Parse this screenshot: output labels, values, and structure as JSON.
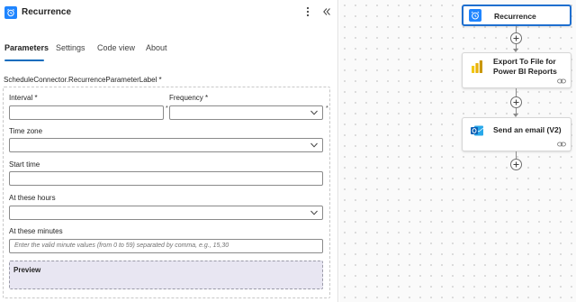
{
  "panel": {
    "title": "Recurrence",
    "more_icon": "more-vertical-icon",
    "collapse_icon": "double-chevron-left-icon",
    "trigger_icon": "alarm-clock-icon"
  },
  "tabs": [
    {
      "label": "Parameters",
      "active": true
    },
    {
      "label": "Settings",
      "active": false
    },
    {
      "label": "Code view",
      "active": false
    },
    {
      "label": "About",
      "active": false
    }
  ],
  "form": {
    "section_label": "ScheduleConnector.RecurrenceParameterLabel *",
    "interval": {
      "label": "Interval *",
      "value": ""
    },
    "frequency": {
      "label": "Frequency *",
      "value": ""
    },
    "time_zone": {
      "label": "Time zone",
      "value": ""
    },
    "start_time": {
      "label": "Start time",
      "value": ""
    },
    "at_these_hours": {
      "label": "At these hours",
      "value": ""
    },
    "at_these_minutes": {
      "label": "At these minutes",
      "placeholder": "Enter the valid minute values (from 0 to 59) separated by comma, e.g., 15,30"
    },
    "required_mark": "*",
    "preview_label": "Preview"
  },
  "canvas": {
    "nodes": [
      {
        "label": "Recurrence",
        "icon": "alarm-clock-icon",
        "selected": true
      },
      {
        "label_line1": "Export To File for",
        "label_line2": "Power BI Reports",
        "icon": "power-bi-icon",
        "link_icon": "link-icon"
      },
      {
        "label": "Send an email (V2)",
        "icon": "outlook-icon",
        "link_icon": "link-icon"
      }
    ],
    "add_icon": "plus-icon"
  },
  "colors": {
    "accent": "#0f6cbd",
    "trigger_blue": "#1f85ff",
    "selected_border": "#1f6fcf",
    "preview_bg": "#e8e6f2",
    "power_bi_yellow": "#f2c811",
    "outlook_blue": "#0a5fb4"
  }
}
